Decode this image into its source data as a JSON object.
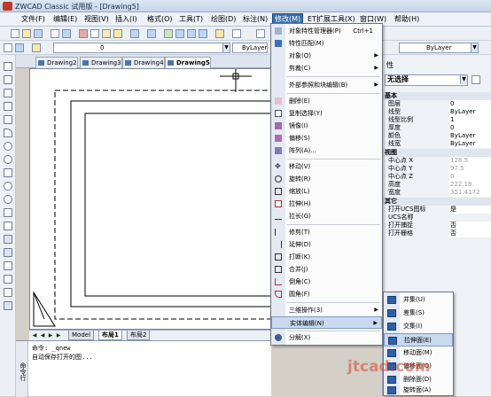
{
  "window": {
    "title": "ZWCAD Classic 试用版 - [Drawing5]"
  },
  "menubar": {
    "items": [
      "文件(F)",
      "编辑(E)",
      "视图(V)",
      "插入(I)",
      "格式(O)",
      "工具(T)",
      "绘图(D)",
      "标注(N)",
      "修改(M)",
      "ET扩展工具(X)",
      "窗口(W)",
      "帮助(H)"
    ],
    "active": "修改(M)"
  },
  "toolbar": {
    "layer_value": "0",
    "linetype_value": "ByLayer",
    "lineweight_value": "ByLayer"
  },
  "doc_tabs": [
    "Drawing2",
    "Drawing3",
    "Drawing4",
    "Drawing5"
  ],
  "doc_tab_active": "Drawing5",
  "model_tabs": [
    "Model",
    "布局1",
    "布局2"
  ],
  "model_tab_active": "布局1",
  "command": {
    "label": "命令行",
    "lines": [
      "命令: _qnew",
      "自动保存打开的图..."
    ]
  },
  "properties": {
    "title": "性",
    "selector_value": "无选择",
    "groups": {
      "basic": "基本",
      "view": "视图",
      "other": "其它"
    },
    "basic_rows": [
      {
        "k": "图层",
        "v": "0"
      },
      {
        "k": "线型",
        "v": "ByLayer"
      },
      {
        "k": "线型比例",
        "v": "1"
      },
      {
        "k": "厚度",
        "v": "0"
      },
      {
        "k": "颜色",
        "v": "ByLayer"
      },
      {
        "k": "线宽",
        "v": "ByLayer"
      }
    ],
    "view_rows": [
      {
        "k": "中心点 X",
        "v": "128.5"
      },
      {
        "k": "中心点 Y",
        "v": "97.5"
      },
      {
        "k": "中心点 Z",
        "v": "0"
      },
      {
        "k": "高度",
        "v": "222.18"
      },
      {
        "k": "宽度",
        "v": "351.4172"
      }
    ],
    "other_rows": [
      {
        "k": "打开UCS图标",
        "v": "是"
      },
      {
        "k": "UCS名称",
        "v": ""
      },
      {
        "k": "打开捕捉",
        "v": "否"
      },
      {
        "k": "打开栅格",
        "v": "否"
      }
    ]
  },
  "modify_menu": {
    "items": [
      {
        "label": "对象特性管理器(P)",
        "shortcut": "Ctrl+1",
        "submenu": false,
        "icon": "properties-icon"
      },
      {
        "label": "特性匹配(M)",
        "shortcut": "",
        "submenu": false,
        "icon": "match-brush-icon"
      },
      {
        "label": "对象(O)",
        "shortcut": "",
        "submenu": true,
        "icon": ""
      },
      {
        "label": "剪裁(C)",
        "shortcut": "",
        "submenu": true,
        "icon": ""
      },
      {
        "label": "外部参照和块编辑(B)",
        "shortcut": "",
        "submenu": true,
        "icon": ""
      },
      {
        "label": "删除(E)",
        "shortcut": "",
        "submenu": false,
        "icon": "eraser-icon"
      },
      {
        "label": "复制选择(Y)",
        "shortcut": "",
        "submenu": false,
        "icon": "copy-icon"
      },
      {
        "label": "镜像(I)",
        "shortcut": "",
        "submenu": false,
        "icon": "mirror-icon"
      },
      {
        "label": "偏移(S)",
        "shortcut": "",
        "submenu": false,
        "icon": "offset-icon"
      },
      {
        "label": "阵列(A)...",
        "shortcut": "",
        "submenu": false,
        "icon": "array-icon"
      },
      {
        "label": "移动(V)",
        "shortcut": "",
        "submenu": false,
        "icon": "move-icon"
      },
      {
        "label": "旋转(R)",
        "shortcut": "",
        "submenu": false,
        "icon": "rotate-icon"
      },
      {
        "label": "缩放(L)",
        "shortcut": "",
        "submenu": false,
        "icon": "scale-icon"
      },
      {
        "label": "拉伸(H)",
        "shortcut": "",
        "submenu": false,
        "icon": "stretch-icon"
      },
      {
        "label": "拉长(G)",
        "shortcut": "",
        "submenu": false,
        "icon": "lengthen-icon"
      },
      {
        "label": "修剪(T)",
        "shortcut": "",
        "submenu": false,
        "icon": "trim-icon"
      },
      {
        "label": "延伸(D)",
        "shortcut": "",
        "submenu": false,
        "icon": "extend-icon"
      },
      {
        "label": "打断(K)",
        "shortcut": "",
        "submenu": false,
        "icon": "break-icon"
      },
      {
        "label": "合并(J)",
        "shortcut": "",
        "submenu": false,
        "icon": "join-icon"
      },
      {
        "label": "倒角(C)",
        "shortcut": "",
        "submenu": false,
        "icon": "chamfer-icon"
      },
      {
        "label": "圆角(F)",
        "shortcut": "",
        "submenu": false,
        "icon": "fillet-icon"
      },
      {
        "label": "三维操作(3)",
        "shortcut": "",
        "submenu": true,
        "icon": ""
      },
      {
        "label": "实体编辑(N)",
        "shortcut": "",
        "submenu": true,
        "icon": ""
      },
      {
        "label": "分解(X)",
        "shortcut": "",
        "submenu": false,
        "icon": "explode-icon"
      }
    ],
    "highlighted": "实体编辑(N)"
  },
  "solid_edit_submenu": {
    "items": [
      "并集(U)",
      "差集(S)",
      "交集(I)",
      "拉伸面(E)",
      "移动面(M)",
      "偏移面(O)",
      "删除面(D)",
      "旋转面(A)"
    ],
    "highlighted": "拉伸面(E)"
  },
  "watermark": "jtcad.com"
}
